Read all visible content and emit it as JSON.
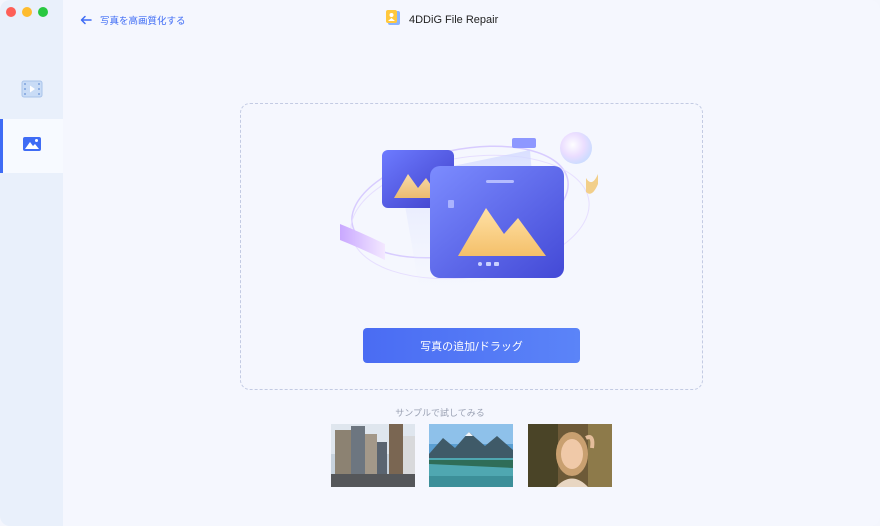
{
  "header": {
    "back_label": "写真を高画質化する",
    "app_title": "4DDiG File Repair"
  },
  "sidebar": {
    "items": [
      {
        "name": "video-repair",
        "active": false
      },
      {
        "name": "photo-enhance",
        "active": true
      }
    ]
  },
  "main": {
    "add_button_label": "写真の追加/ドラッグ",
    "sample_label": "サンプルで試してみる",
    "samples": [
      "city-buildings",
      "mountain-lake",
      "woman-portrait"
    ]
  },
  "colors": {
    "accent": "#3f6cf5",
    "button": "#4a6cf3"
  }
}
